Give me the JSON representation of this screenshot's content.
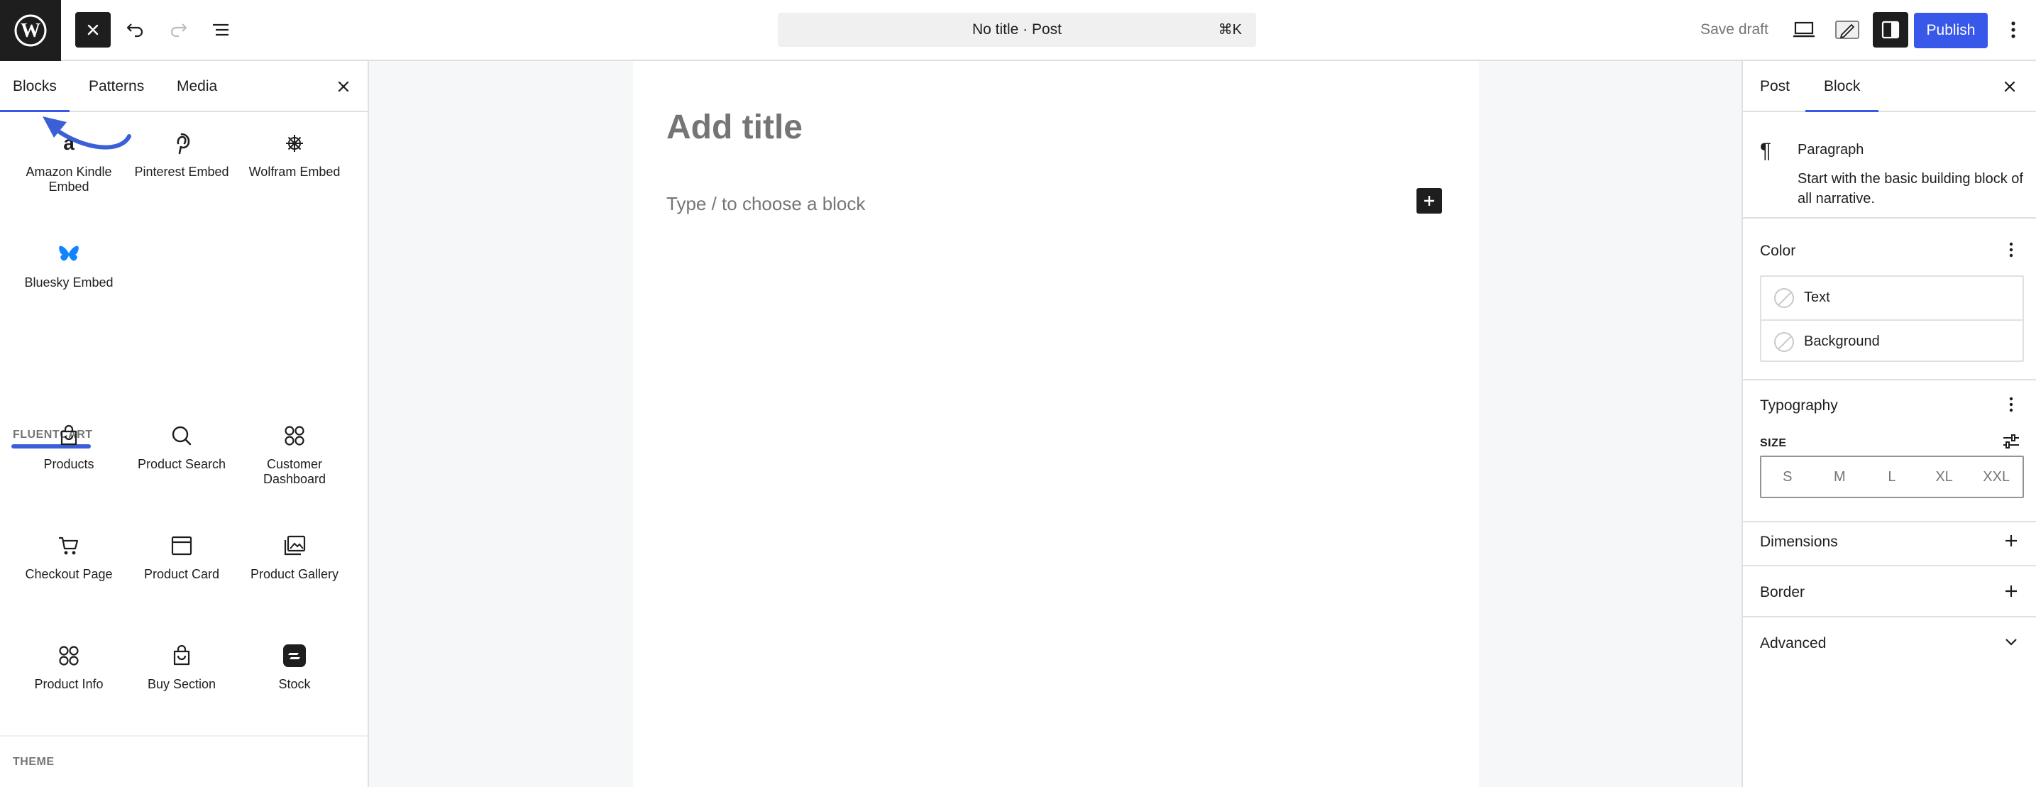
{
  "toolbar": {
    "document_title": "No title · Post",
    "shortcut": "⌘K",
    "save_draft": "Save draft",
    "publish": "Publish"
  },
  "inserter": {
    "tabs": [
      "Blocks",
      "Patterns",
      "Media"
    ],
    "embed_blocks": [
      {
        "label": "Amazon Kindle Embed",
        "icon": "amazon-icon"
      },
      {
        "label": "Pinterest Embed",
        "icon": "pinterest-icon"
      },
      {
        "label": "Wolfram Embed",
        "icon": "wolfram-icon"
      },
      {
        "label": "Bluesky Embed",
        "icon": "bluesky-icon"
      }
    ],
    "fluentcart_heading": "FLUENTCART",
    "fluentcart_blocks": [
      {
        "label": "Products",
        "icon": "shopping-bag-icon"
      },
      {
        "label": "Product Search",
        "icon": "search-icon"
      },
      {
        "label": "Customer Dashboard",
        "icon": "grid-circles-icon"
      },
      {
        "label": "Checkout Page",
        "icon": "cart-icon"
      },
      {
        "label": "Product Card",
        "icon": "card-icon"
      },
      {
        "label": "Product Gallery",
        "icon": "gallery-icon"
      },
      {
        "label": "Product Info",
        "icon": "grid-circles-icon"
      },
      {
        "label": "Buy Section",
        "icon": "shopping-bag-icon"
      },
      {
        "label": "Stock",
        "icon": "stock-icon"
      }
    ],
    "theme_heading": "THEME"
  },
  "editor": {
    "title_placeholder": "Add title",
    "paragraph_placeholder": "Type / to choose a block"
  },
  "sidebar": {
    "tabs": [
      "Post",
      "Block"
    ],
    "block_name": "Paragraph",
    "block_description": "Start with the basic building block of all narrative.",
    "color_title": "Color",
    "color_items": [
      "Text",
      "Background"
    ],
    "typography_title": "Typography",
    "size_label": "SIZE",
    "size_options": [
      "S",
      "M",
      "L",
      "XL",
      "XXL"
    ],
    "dimensions_title": "Dimensions",
    "border_title": "Border",
    "advanced_title": "Advanced"
  },
  "colors": {
    "accent": "#3858e9",
    "dark": "#1e1e1e",
    "muted": "#757575",
    "bluesky": "#1185fe",
    "annotation": "#3b5fd6"
  }
}
